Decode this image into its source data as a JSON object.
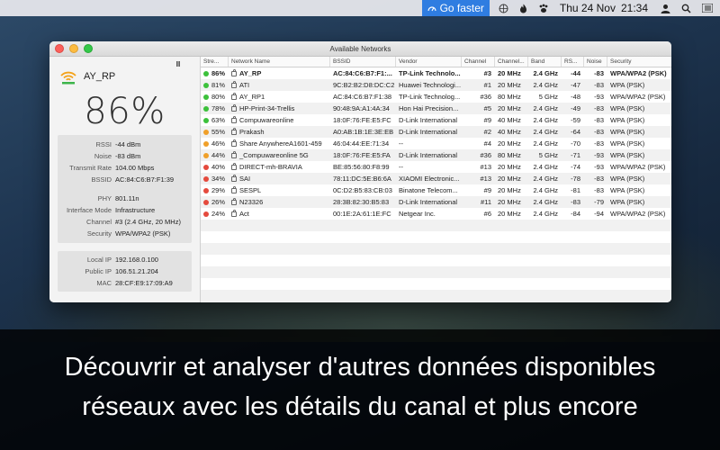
{
  "menubar": {
    "go_faster": "Go faster",
    "date": "Thu 24 Nov",
    "time": "21:34",
    "icons": [
      "vpn-speed-icon",
      "basketball-icon",
      "flame-icon",
      "paw-icon",
      "user-icon",
      "search-icon",
      "list-icon"
    ]
  },
  "window": {
    "title": "Available Networks"
  },
  "current_network": {
    "ssid": "AY_RP",
    "quality": "86%",
    "pause_label": "II",
    "group1": [
      {
        "k": "RSSI",
        "v": "-44 dBm"
      },
      {
        "k": "Noise",
        "v": "-83 dBm"
      },
      {
        "k": "Transmit Rate",
        "v": "104.00 Mbps"
      },
      {
        "k": "BSSID",
        "v": "AC:84:C6:B7:F1:39"
      }
    ],
    "group2": [
      {
        "k": "PHY",
        "v": "801.11n"
      },
      {
        "k": "Interface Mode",
        "v": "Infrastructure"
      },
      {
        "k": "Channel",
        "v": "#3 (2.4 GHz, 20 MHz)"
      },
      {
        "k": "Security",
        "v": "WPA/WPA2 (PSK)"
      }
    ],
    "group3": [
      {
        "k": "Local IP",
        "v": "192.168.0.100"
      },
      {
        "k": "Public IP",
        "v": "106.51.21.204"
      },
      {
        "k": "MAC",
        "v": "28:CF:E9:17:09:A9"
      }
    ]
  },
  "table": {
    "headers": [
      "Stre...",
      "Network Name",
      "BSSID",
      "Vendor",
      "Channel",
      "Channel...",
      "Band",
      "RS...",
      "Noise",
      "Security"
    ],
    "rows": [
      {
        "strength": "86%",
        "color": "#3cc13b",
        "name": "AY_RP",
        "bssid": "AC:84:C6:B7:F1:...",
        "vendor": "TP-Link Technolo...",
        "channel": "#3",
        "width": "20 MHz",
        "band": "2.4 GHz",
        "rssi": "-44",
        "noise": "-83",
        "security": "WPA/WPA2 (PSK)",
        "bold": true
      },
      {
        "strength": "81%",
        "color": "#3cc13b",
        "name": "ATI",
        "bssid": "9C:B2:B2:D8:DC:C2",
        "vendor": "Huawei Technologi...",
        "channel": "#1",
        "width": "20 MHz",
        "band": "2.4 GHz",
        "rssi": "-47",
        "noise": "-83",
        "security": "WPA (PSK)"
      },
      {
        "strength": "80%",
        "color": "#3cc13b",
        "name": "AY_RP1",
        "bssid": "AC:84:C6:B7:F1:38",
        "vendor": "TP-Link Technolog...",
        "channel": "#36",
        "width": "80 MHz",
        "band": "5 GHz",
        "rssi": "-48",
        "noise": "-93",
        "security": "WPA/WPA2 (PSK)"
      },
      {
        "strength": "78%",
        "color": "#3cc13b",
        "name": "HP-Print-34-Trellis",
        "bssid": "90:48:9A:A1:4A:34",
        "vendor": "Hon Hai Precision...",
        "channel": "#5",
        "width": "20 MHz",
        "band": "2.4 GHz",
        "rssi": "-49",
        "noise": "-83",
        "security": "WPA (PSK)"
      },
      {
        "strength": "63%",
        "color": "#3cc13b",
        "name": "Compuwareonline",
        "bssid": "18:0F:76:FE:E5:FC",
        "vendor": "D-Link International",
        "channel": "#9",
        "width": "40 MHz",
        "band": "2.4 GHz",
        "rssi": "-59",
        "noise": "-83",
        "security": "WPA (PSK)"
      },
      {
        "strength": "55%",
        "color": "#f0a02a",
        "name": "Prakash",
        "bssid": "A0:AB:1B:1E:3E:EB",
        "vendor": "D-Link International",
        "channel": "#2",
        "width": "40 MHz",
        "band": "2.4 GHz",
        "rssi": "-64",
        "noise": "-83",
        "security": "WPA (PSK)"
      },
      {
        "strength": "46%",
        "color": "#f0a02a",
        "name": "Share AnywhereA1601-459",
        "bssid": "46:04:44:EE:71:34",
        "vendor": "--",
        "channel": "#4",
        "width": "20 MHz",
        "band": "2.4 GHz",
        "rssi": "-70",
        "noise": "-83",
        "security": "WPA (PSK)"
      },
      {
        "strength": "44%",
        "color": "#f0a02a",
        "name": "_Compuwareonline 5G",
        "bssid": "18:0F:76:FE:E5:FA",
        "vendor": "D-Link International",
        "channel": "#36",
        "width": "80 MHz",
        "band": "5 GHz",
        "rssi": "-71",
        "noise": "-93",
        "security": "WPA (PSK)"
      },
      {
        "strength": "40%",
        "color": "#e54a3d",
        "name": "DIRECT-mh-BRAVIA",
        "bssid": "BE:85:56:80:F8:99",
        "vendor": "--",
        "channel": "#13",
        "width": "20 MHz",
        "band": "2.4 GHz",
        "rssi": "-74",
        "noise": "-93",
        "security": "WPA/WPA2 (PSK)"
      },
      {
        "strength": "34%",
        "color": "#e54a3d",
        "name": "SAI",
        "bssid": "78:11:DC:5E:B6:6A",
        "vendor": "XIAOMI Electronic...",
        "channel": "#13",
        "width": "20 MHz",
        "band": "2.4 GHz",
        "rssi": "-78",
        "noise": "-83",
        "security": "WPA (PSK)"
      },
      {
        "strength": "29%",
        "color": "#e54a3d",
        "name": "SESPL",
        "bssid": "0C:D2:B5:83:CB:03",
        "vendor": "Binatone Telecom...",
        "channel": "#9",
        "width": "20 MHz",
        "band": "2.4 GHz",
        "rssi": "-81",
        "noise": "-83",
        "security": "WPA (PSK)"
      },
      {
        "strength": "26%",
        "color": "#e54a3d",
        "name": "N23326",
        "bssid": "28:3B:82:30:B5:83",
        "vendor": "D-Link International",
        "channel": "#11",
        "width": "20 MHz",
        "band": "2.4 GHz",
        "rssi": "-83",
        "noise": "-79",
        "security": "WPA (PSK)"
      },
      {
        "strength": "24%",
        "color": "#e54a3d",
        "name": "Act",
        "bssid": "00:1E:2A:61:1E:FC",
        "vendor": "Netgear Inc.",
        "channel": "#6",
        "width": "20 MHz",
        "band": "2.4 GHz",
        "rssi": "-84",
        "noise": "-94",
        "security": "WPA/WPA2 (PSK)"
      }
    ],
    "empty_rows": 7
  },
  "caption": {
    "line1": "Découvrir et analyser d'autres données disponibles",
    "line2": "réseaux avec les détails du canal et plus encore"
  }
}
